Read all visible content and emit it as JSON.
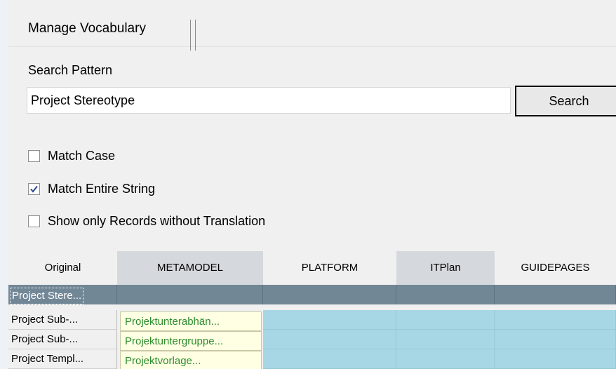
{
  "window": {
    "tab_title": "Manage Vocabulary"
  },
  "search": {
    "label": "Search Pattern",
    "value": "Project Stereotype",
    "button_label": "Search"
  },
  "options": {
    "match_case": {
      "label": "Match Case",
      "checked": false
    },
    "match_entire": {
      "label": "Match Entire String",
      "checked": true
    },
    "show_untranslated": {
      "label": "Show only Records without Translation",
      "checked": false
    }
  },
  "grid": {
    "columns": [
      "Original",
      "METAMODEL",
      "PLATFORM",
      "ITPlan",
      "GUIDEPAGES"
    ],
    "rows": [
      {
        "original": "Project Stere...",
        "metamodel": "",
        "selected": true
      },
      {
        "original": "Project Sub-...",
        "metamodel": "Projektunterabhän...",
        "selected": false
      },
      {
        "original": "Project Sub-...",
        "metamodel": "Projektuntergruppe...",
        "selected": false
      },
      {
        "original": "Project Templ...",
        "metamodel": "Projektvorlage...",
        "selected": false
      }
    ]
  },
  "colors": {
    "selected_row": "#728796",
    "translation_cell": "#ffffe3",
    "translation_text": "#2c8c2c",
    "empty_cell": "#a7d7e5"
  }
}
